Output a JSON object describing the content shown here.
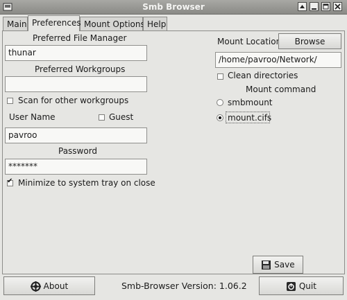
{
  "window": {
    "title": "Smb Browser",
    "controls": {
      "shade": "▲",
      "minimize": "_",
      "maximize": "□",
      "close": "✕"
    }
  },
  "tabs": [
    {
      "label": "Main",
      "active": false
    },
    {
      "label": "Preferences",
      "active": true
    },
    {
      "label": "Mount Options",
      "active": false
    },
    {
      "label": "Help",
      "active": false
    }
  ],
  "preferences": {
    "file_manager_label": "Preferred File Manager",
    "file_manager_value": "thunar",
    "workgroups_label": "Preferred Workgroups",
    "workgroups_value": "",
    "scan_label": "Scan for other workgroups",
    "scan_checked": false,
    "username_label": "User Name",
    "guest_label": "Guest",
    "guest_checked": false,
    "username_value": "pavroo",
    "password_label": "Password",
    "password_value": "*******",
    "tray_label": "Minimize to system tray on close",
    "tray_checked": true,
    "mount_location_label": "Mount Location",
    "browse_label": "Browse",
    "mount_location_value": "/home/pavroo/Network/",
    "clean_label": "Clean directories",
    "clean_checked": false,
    "mount_command_label": "Mount command",
    "mount_options": [
      {
        "label": "smbmount",
        "selected": false
      },
      {
        "label": "mount.cifs",
        "selected": true
      }
    ],
    "save_label": "Save"
  },
  "footer": {
    "about_label": "About",
    "version_text": "Smb-Browser Version: 1.06.2",
    "quit_label": "Quit"
  },
  "icons": {
    "save": "floppy-disk-icon",
    "about": "about-icon",
    "quit": "quit-icon"
  }
}
